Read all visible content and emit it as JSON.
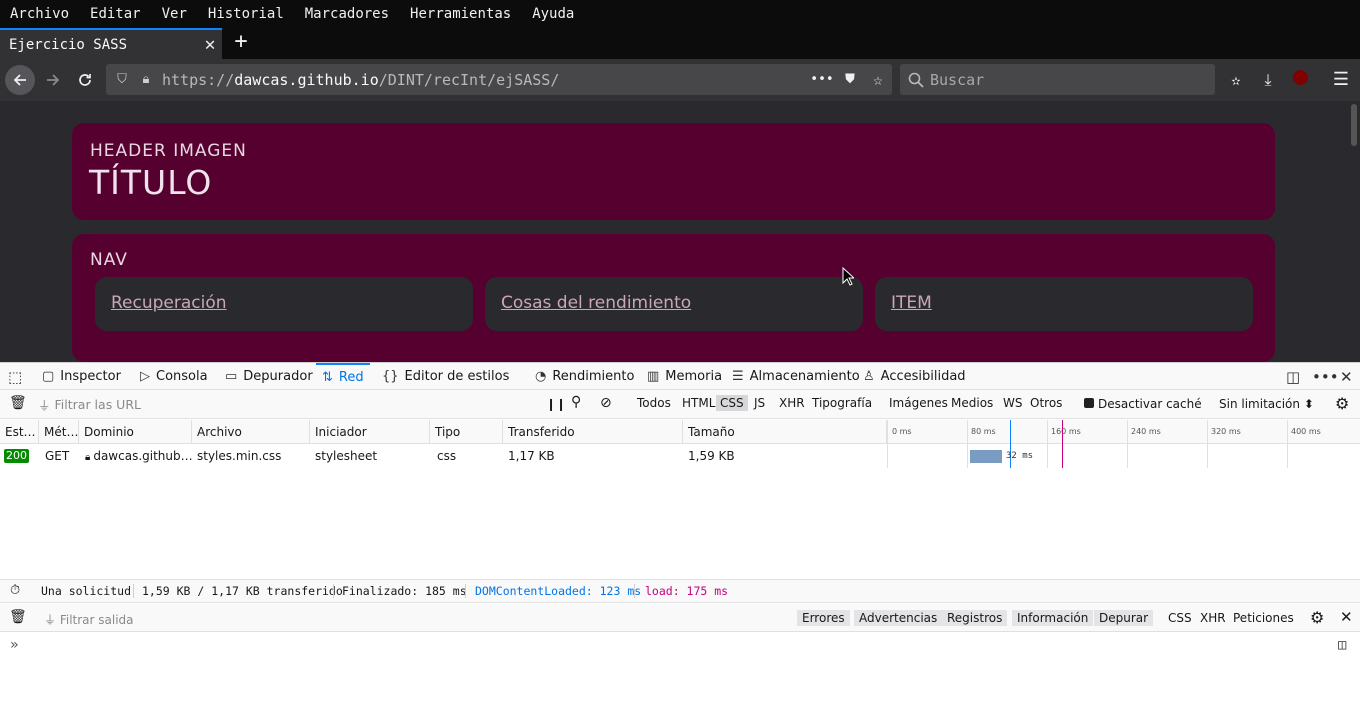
{
  "menubar": [
    "Archivo",
    "Editar",
    "Ver",
    "Historial",
    "Marcadores",
    "Herramientas",
    "Ayuda"
  ],
  "tab": {
    "title": "Ejercicio SASS"
  },
  "url": {
    "prefix": "https://",
    "host": "dawcas.github.io",
    "path": "/DINT/recInt/ejSASS/"
  },
  "search": {
    "placeholder": "Buscar"
  },
  "page": {
    "header_sub": "HEADER IMAGEN",
    "header_title": "TÍTULO",
    "nav_label": "NAV",
    "nav_items": [
      "Recuperación",
      "Cosas del rendimiento",
      "ITEM"
    ]
  },
  "devtools": {
    "tabs": [
      "Inspector",
      "Consola",
      "Depurador",
      "Red",
      "Editor de estilos",
      "Rendimiento",
      "Memoria",
      "Almacenamiento",
      "Accesibilidad"
    ],
    "filter_placeholder": "Filtrar las URL",
    "type_filters": [
      "Todos",
      "HTML",
      "CSS",
      "JS",
      "XHR",
      "Tipografía",
      "Imágenes",
      "Medios",
      "WS",
      "Otros"
    ],
    "disable_cache": "Desactivar caché",
    "throttling": "Sin limitación",
    "columns": [
      "Est…",
      "Mét…",
      "Dominio",
      "Archivo",
      "Iniciador",
      "Tipo",
      "Transferido",
      "Tamaño"
    ],
    "timeline_ticks": [
      "0 ms",
      "80 ms",
      "160 ms",
      "240 ms",
      "320 ms",
      "400 ms"
    ],
    "request": {
      "status": "200",
      "method": "GET",
      "domain": "dawcas.github…",
      "file": "styles.min.css",
      "initiator": "stylesheet",
      "type": "css",
      "transferred": "1,17 KB",
      "size": "1,59 KB",
      "timing": "32 ms"
    },
    "summary": {
      "requests": "Una solicitud",
      "sizes": "1,59 KB / 1,17 KB transferido",
      "finished": "Finalizado: 185 ms",
      "dcl": "DOMContentLoaded: 123 ms",
      "load": "load: 175 ms"
    },
    "console": {
      "filter_placeholder": "Filtrar salida",
      "levels": [
        "Errores",
        "Advertencias",
        "Registros",
        "Información",
        "Depurar"
      ],
      "extras": [
        "CSS",
        "XHR",
        "Peticiones"
      ]
    }
  },
  "colors": {
    "accent": "#0a84ff",
    "box": "#560030",
    "page_bg": "#2a2a2e",
    "status_ok": "#058b00",
    "dcl": "#0074e8",
    "load": "#c5007f"
  }
}
